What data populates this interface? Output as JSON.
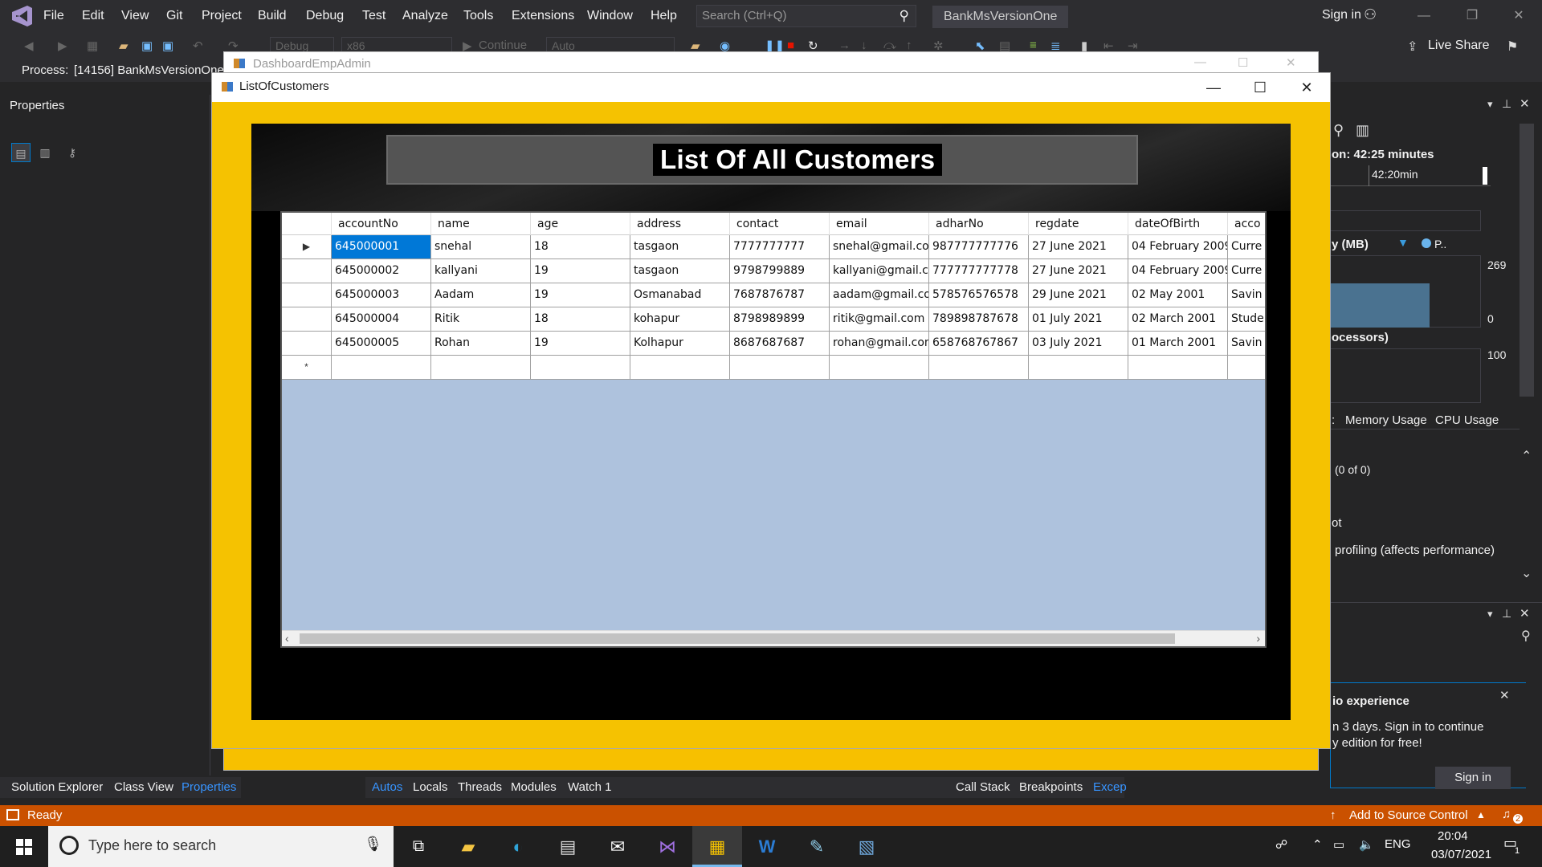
{
  "vs": {
    "menu": [
      "File",
      "Edit",
      "View",
      "Git",
      "Project",
      "Build",
      "Debug",
      "Test",
      "Analyze",
      "Tools",
      "Extensions",
      "Window",
      "Help"
    ],
    "search_placeholder": "Search (Ctrl+Q)",
    "solution_name": "BankMsVersionOne",
    "signin_label": "Sign in",
    "toolbar": {
      "config": "Debug",
      "platform": "x86",
      "continue_label": "Continue",
      "target": "Auto"
    },
    "liveshare_label": "Live Share",
    "process_label": "Process:",
    "process_value": "[14156] BankMsVersionOne",
    "properties_title": "Properties",
    "diagnostics": {
      "session_label": "on: 42:25 minutes",
      "timeline_tick": "42:20min",
      "memory_label": "y (MB)",
      "legend_label": "P..",
      "mem_max": "269",
      "mem_min": "0",
      "cpu_label": "ocessors)",
      "cpu_max": "100",
      "tab_memory": "Memory Usage",
      "tab_cpu": "CPU Usage",
      "events_count": "(0 of 0)",
      "snapshot_label": "ot",
      "profiling_label": "profiling (affects performance)",
      "notif_title": "io experience",
      "notif_body_1": "n 3 days. Sign in to continue",
      "notif_body_2": "y edition for free!",
      "notif_button": "Sign in"
    },
    "bottom_tabs_left": [
      "Solution Explorer",
      "Class View",
      "Properties"
    ],
    "bottom_tabs_mid": [
      "Autos",
      "Locals",
      "Threads",
      "Modules",
      "Watch 1"
    ],
    "bottom_tabs_right": [
      "Call Stack",
      "Breakpoints",
      "Excep"
    ],
    "status_ready": "Ready",
    "status_source_control": "Add to Source Control",
    "status_notifications": "2",
    "colors": {
      "statusbar": "#ca5100",
      "accent": "#007acc",
      "window_bg": "#f5c201"
    }
  },
  "dashboard_window": {
    "title": "DashboardEmpAdmin"
  },
  "customers_window": {
    "title": "ListOfCustomers",
    "heading": "List Of All Customers",
    "grid": {
      "columns": [
        "accountNo",
        "name",
        "age",
        "address",
        "contact",
        "email",
        "adharNo",
        "regdate",
        "dateOfBirth",
        "acco"
      ],
      "rows": [
        [
          "645000001",
          "snehal",
          "18",
          "tasgaon",
          "7777777777",
          "snehal@gmail.com",
          "987777777776",
          "27 June 2021",
          "04 February 2009",
          "Curre"
        ],
        [
          "645000002",
          "kallyani",
          "19",
          "tasgaon",
          "9798799889",
          "kallyani@gmail.c...",
          "777777777778",
          "27 June 2021",
          "04 February 2009",
          "Curre"
        ],
        [
          "645000003",
          "Aadam",
          "19",
          "Osmanabad",
          "7687876787",
          "aadam@gmail.com",
          "578576576578",
          "29 June 2021",
          "02 May 2001",
          "Savin"
        ],
        [
          "645000004",
          "Ritik",
          "18",
          "kohapur",
          "8798989899",
          "ritik@gmail.com",
          "789898787678",
          "01 July 2021",
          "02 March 2001",
          "Stude"
        ],
        [
          "645000005",
          "Rohan",
          "19",
          "Kolhapur",
          "8687687687",
          "rohan@gmail.com",
          "658768767867",
          "03 July 2021",
          "01 March 2001",
          "Savin"
        ]
      ],
      "selected_row": 0,
      "selected_col": 0,
      "current_row_glyph": "▶",
      "new_row_glyph": "*"
    }
  },
  "taskbar": {
    "search_placeholder": "Type here to search",
    "language": "ENG",
    "time": "20:04",
    "date": "03/07/2021",
    "notification_count": "1",
    "apps": [
      "task-view-icon",
      "file-explorer-icon",
      "edge-icon",
      "store-icon",
      "mail-icon",
      "visual-studio-icon",
      "winforms-app-icon",
      "word-icon",
      "paint-icon",
      "sql-server-icon"
    ]
  }
}
